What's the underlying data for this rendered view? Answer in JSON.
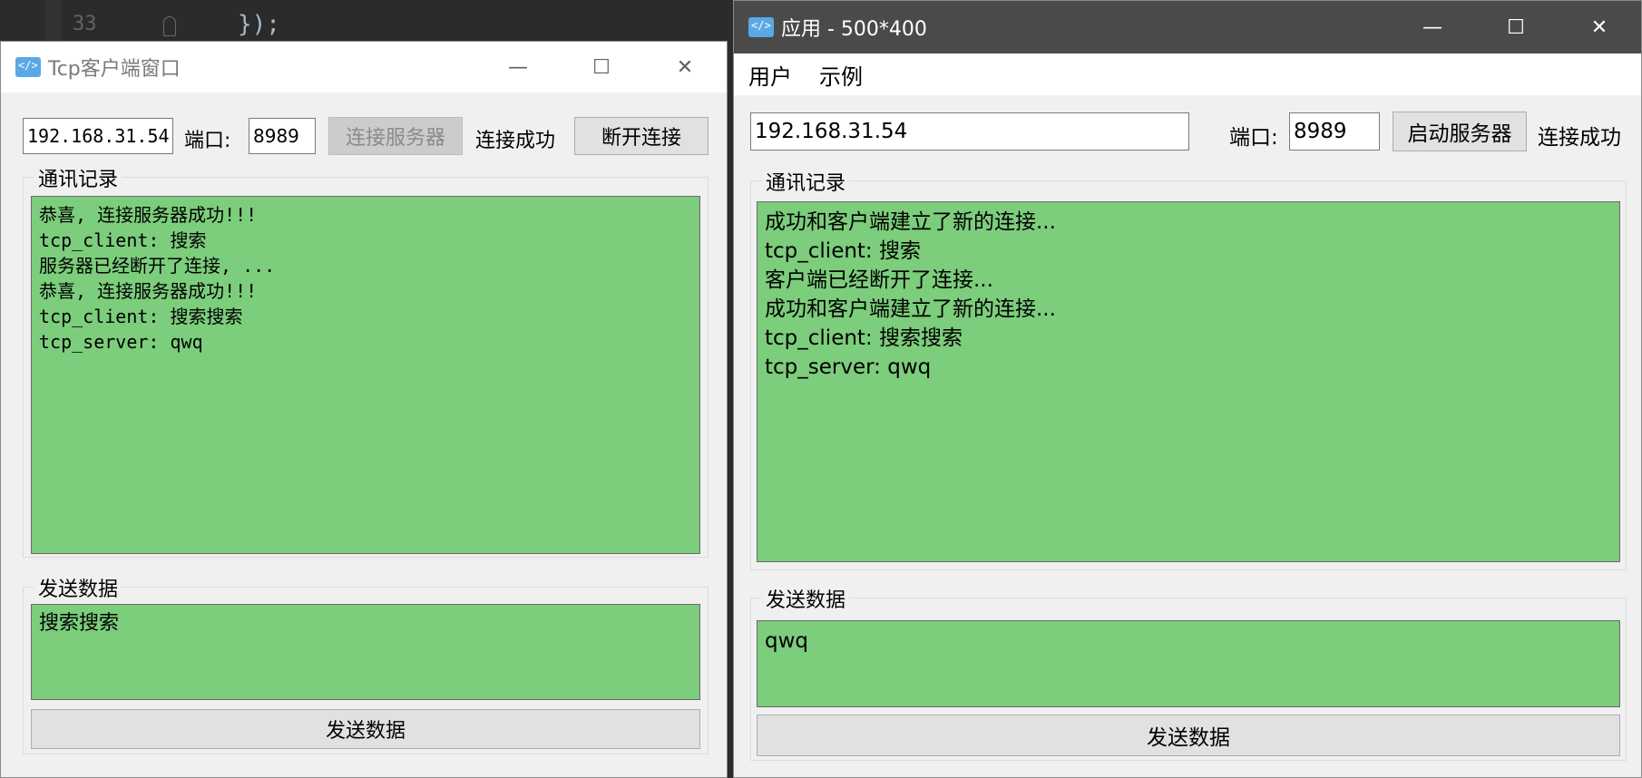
{
  "editor": {
    "line_number": "33",
    "code_text": "});"
  },
  "client": {
    "title": "Tcp客户端窗口",
    "icon": "code-icon",
    "controls": {
      "minimize": "—",
      "maximize": "☐",
      "close": "✕"
    },
    "ip": "192.168.31.54",
    "port_label": "端口:",
    "port": "8989",
    "connect_button": "连接服务器",
    "status": "连接成功",
    "disconnect_button": "断开连接",
    "log_group_title": "通讯记录",
    "log_lines": [
      "恭喜, 连接服务器成功!!!",
      "tcp_client: 搜索",
      "服务器已经断开了连接, ...",
      "恭喜, 连接服务器成功!!!",
      "tcp_client: 搜索搜索",
      "tcp_server: qwq"
    ],
    "send_group_title": "发送数据",
    "send_text": "搜索搜索",
    "send_button": "发送数据"
  },
  "server": {
    "title": "应用 - 500*400",
    "icon": "code-icon",
    "controls": {
      "minimize": "—",
      "maximize": "☐",
      "close": "✕"
    },
    "menu": [
      "用户",
      "示例"
    ],
    "ip": "192.168.31.54",
    "port_label": "端口:",
    "port": "8989",
    "start_button": "启动服务器",
    "status": "连接成功",
    "log_group_title": "通讯记录",
    "log_lines": [
      "成功和客户端建立了新的连接...",
      "tcp_client: 搜索",
      "客户端已经断开了连接...",
      "成功和客户端建立了新的连接...",
      "tcp_client: 搜索搜索",
      "tcp_server: qwq"
    ],
    "send_group_title": "发送数据",
    "send_text": "qwq",
    "send_button": "发送数据"
  },
  "colors": {
    "log_background": "#7ccd7c",
    "server_titlebar": "#4a4a4a",
    "window_background": "#f0f0f0"
  }
}
